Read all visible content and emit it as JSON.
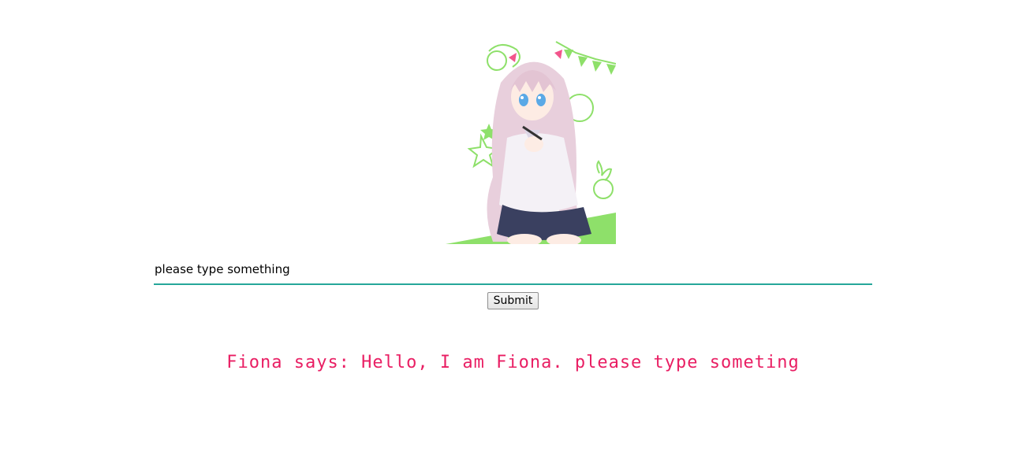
{
  "avatar": {
    "alt": "anime girl avatar"
  },
  "chat": {
    "input_placeholder": "please type something",
    "input_value": "",
    "submit_label": "Submit",
    "reply_text": "Fiona says: Hello, I am Fiona. please type someting"
  },
  "colors": {
    "input_underline": "#26a69a",
    "reply_text": "#e91e63",
    "doodle_green": "#8ee06a"
  }
}
